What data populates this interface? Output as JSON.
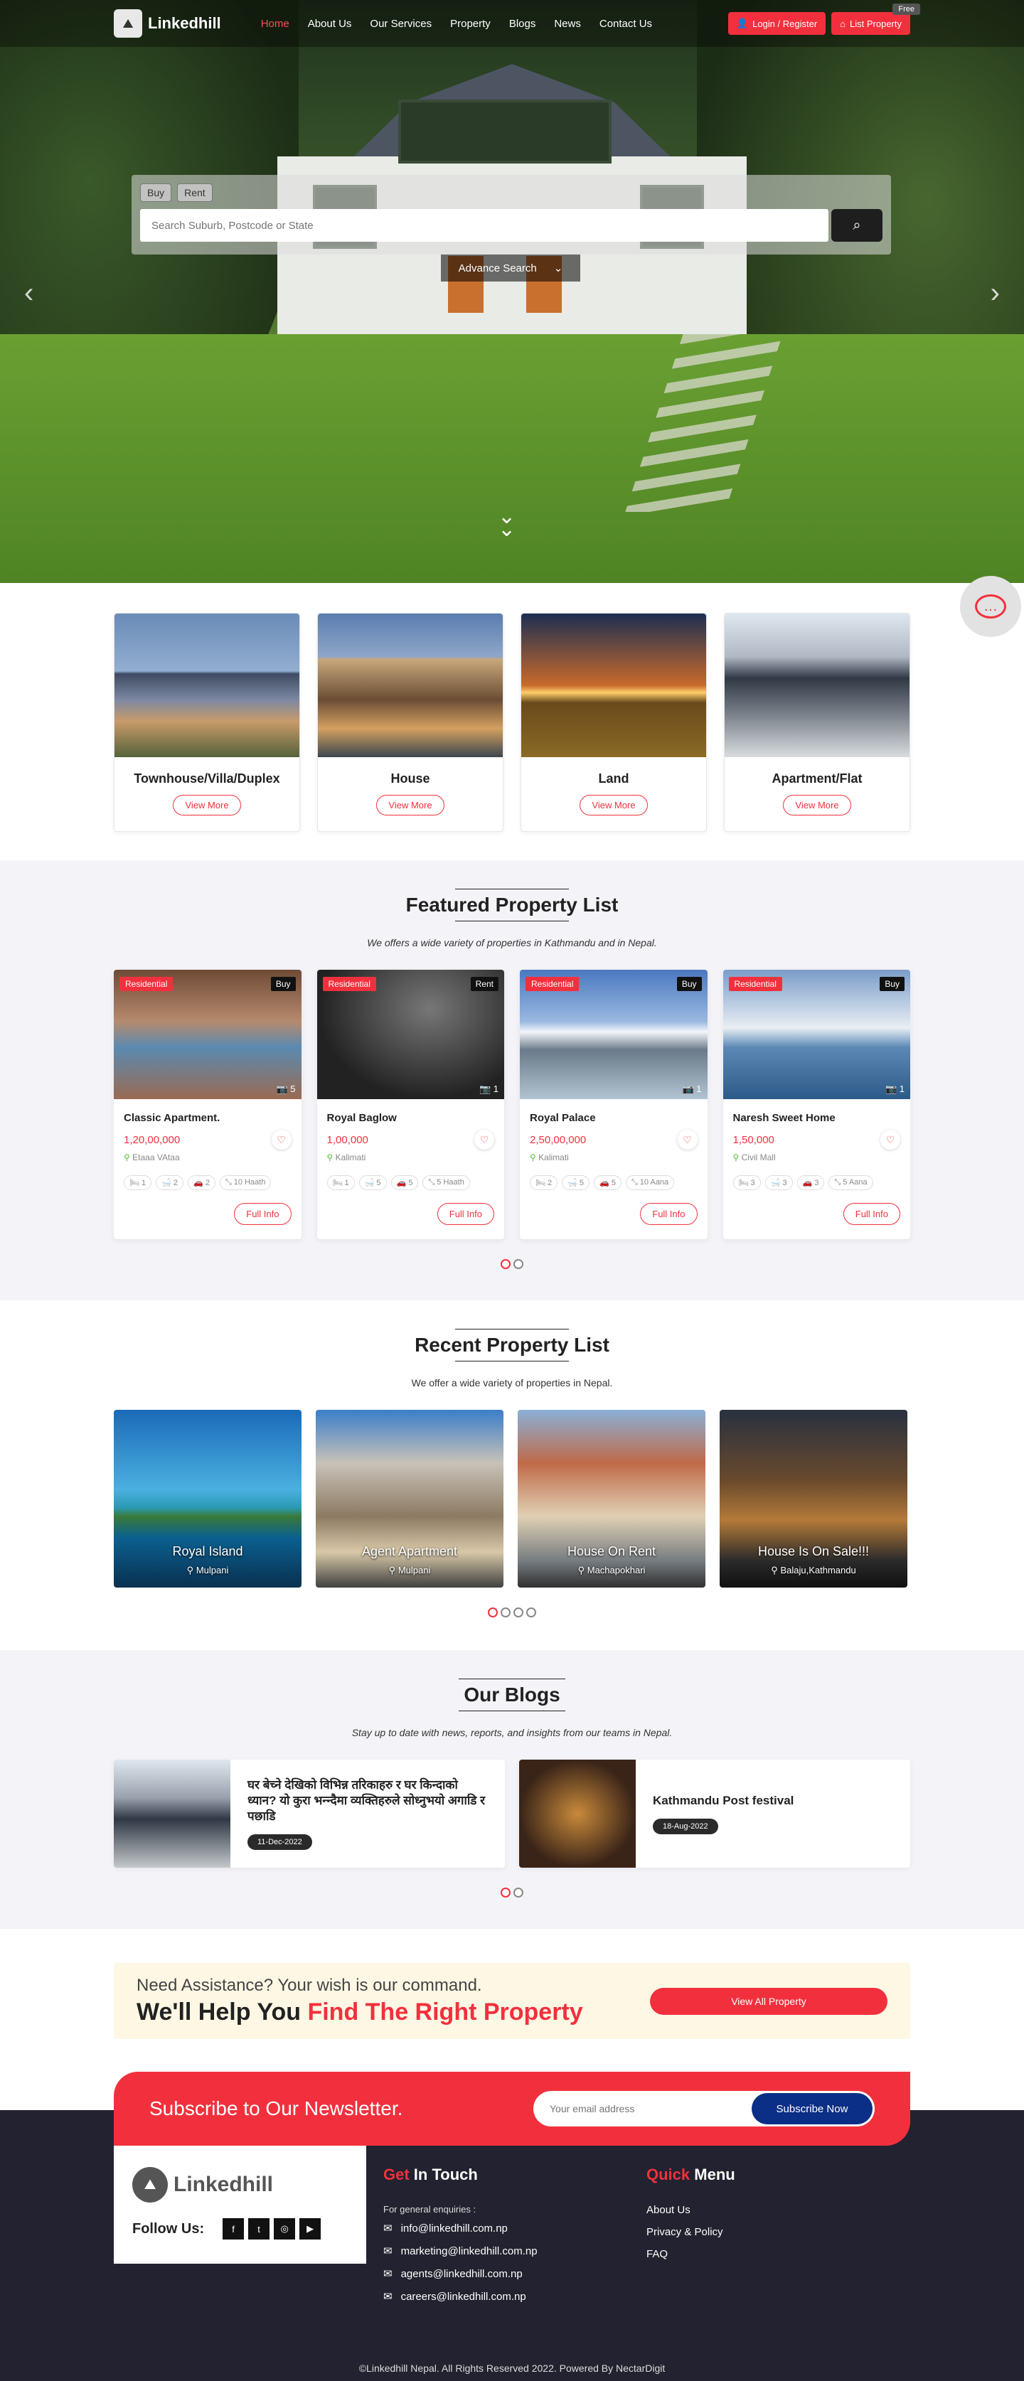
{
  "nav": {
    "brand": "Linkedhill",
    "links": [
      "Home",
      "About Us",
      "Our Services",
      "Property",
      "Blogs",
      "News",
      "Contact Us"
    ],
    "active": "Home",
    "login": "Login / Register",
    "list_property": "List Property",
    "free_badge": "Free"
  },
  "hero": {
    "tabs": [
      "Buy",
      "Rent"
    ],
    "search_placeholder": "Search Suburb, Postcode or State",
    "advance_search": "Advance Search"
  },
  "categories": [
    {
      "title": "Townhouse/Villa/Duplex",
      "cta": "View More"
    },
    {
      "title": "House",
      "cta": "View More"
    },
    {
      "title": "Land",
      "cta": "View More"
    },
    {
      "title": "Apartment/Flat",
      "cta": "View More"
    }
  ],
  "featured": {
    "title": "Featured Property List",
    "subtitle": "We offers a wide variety of properties in Kathmandu and in Nepal.",
    "items": [
      {
        "tag": "Residential",
        "type": "Buy",
        "photos": "5",
        "name": "Classic Apartment.",
        "price": "1,20,00,000",
        "location": "Etaaa VAtaa",
        "beds": "1",
        "baths": "2",
        "parking": "2",
        "area": "10 Haath",
        "cta": "Full Info"
      },
      {
        "tag": "Residential",
        "type": "Rent",
        "photos": "1",
        "name": "Royal Baglow",
        "price": "1,00,000",
        "location": "Kalimati",
        "beds": "1",
        "baths": "5",
        "parking": "5",
        "area": "5 Haath",
        "cta": "Full Info"
      },
      {
        "tag": "Residential",
        "type": "Buy",
        "photos": "1",
        "name": "Royal Palace",
        "price": "2,50,00,000",
        "location": "Kalimati",
        "beds": "2",
        "baths": "5",
        "parking": "5",
        "area": "10 Aana",
        "cta": "Full Info"
      },
      {
        "tag": "Residential",
        "type": "Buy",
        "photos": "1",
        "name": "Naresh Sweet Home",
        "price": "1,50,000",
        "location": "Civil Mall",
        "beds": "3",
        "baths": "3",
        "parking": "3",
        "area": "5 Aana",
        "cta": "Full Info"
      }
    ]
  },
  "recent": {
    "title": "Recent Property List",
    "subtitle": "We offer a wide variety of properties in Nepal.",
    "items": [
      {
        "name": "Royal Island",
        "location": "Mulpani"
      },
      {
        "name": "Agent Apartment",
        "location": "Mulpani"
      },
      {
        "name": "House On Rent",
        "location": "Machapokhari"
      },
      {
        "name": "House Is On Sale!!!",
        "location": "Balaju,Kathmandu"
      }
    ]
  },
  "blogs": {
    "title": "Our Blogs",
    "subtitle": "Stay up to date with news, reports, and insights from our teams in Nepal.",
    "items": [
      {
        "title": "घर बेच्ने देखिको विभिन्न तरिकाहरु र घर किन्दाको ध्यान? यो कुरा भन्न्दैमा व्यक्तिहरुले सोध्नुभयो अगाडि र पछाडि",
        "date": "11-Dec-2022"
      },
      {
        "title": "Kathmandu Post festival",
        "date": "18-Aug-2022"
      }
    ]
  },
  "cta": {
    "small": "Need Assistance? Your wish is our command.",
    "big_plain": "We'll Help You ",
    "big_red": "Find The Right Property",
    "button": "View All Property"
  },
  "newsletter": {
    "title": "Subscribe to Our Newsletter.",
    "placeholder": "Your email address",
    "button": "Subscribe Now"
  },
  "footer": {
    "brand": "Linkedhill",
    "follow": "Follow Us:",
    "touch_red": "Get",
    "touch_rest": " In Touch",
    "enquiries": "For general enquiries :",
    "emails": [
      "info@linkedhill.com.np",
      "marketing@linkedhill.com.np",
      "agents@linkedhill.com.np",
      "careers@linkedhill.com.np"
    ],
    "menu_red": "Quick",
    "menu_rest": " Menu",
    "menu": [
      "About Us",
      "Privacy & Policy",
      "FAQ"
    ],
    "copyright": "©Linkedhill Nepal. All Rights Reserved 2022. Powered By NectarDigit"
  },
  "colors": {
    "accent": "#f2303d",
    "dark": "#222230",
    "newsletter_button": "#0b2e86"
  }
}
